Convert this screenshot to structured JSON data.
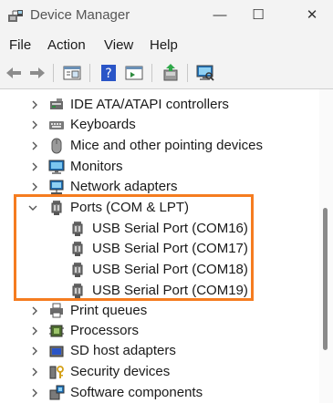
{
  "window": {
    "title": "Device Manager",
    "minimize_glyph": "—",
    "maximize_glyph": "☐",
    "close_glyph": "✕"
  },
  "menu": [
    "File",
    "Action",
    "View",
    "Help"
  ],
  "toolbar": {
    "buttons": [
      "back-icon",
      "forward-icon",
      "properties-icon",
      "help-icon",
      "view-icon",
      "update-driver-icon",
      "scan-hardware-icon"
    ]
  },
  "tree": {
    "items": [
      {
        "label": "IDE ATA/ATAPI controllers",
        "icon": "ide-controller-icon",
        "expanded": false
      },
      {
        "label": "Keyboards",
        "icon": "keyboard-icon",
        "expanded": false
      },
      {
        "label": "Mice and other pointing devices",
        "icon": "mouse-icon",
        "expanded": false
      },
      {
        "label": "Monitors",
        "icon": "monitor-icon",
        "expanded": false
      },
      {
        "label": "Network adapters",
        "icon": "network-adapter-icon",
        "expanded": false
      },
      {
        "label": "Ports (COM & LPT)",
        "icon": "port-icon",
        "expanded": true
      },
      {
        "label": "USB Serial Port (COM16)",
        "icon": "port-icon",
        "child": true
      },
      {
        "label": "USB Serial Port (COM17)",
        "icon": "port-icon",
        "child": true
      },
      {
        "label": "USB Serial Port (COM18)",
        "icon": "port-icon",
        "child": true
      },
      {
        "label": "USB Serial Port (COM19)",
        "icon": "port-icon",
        "child": true
      },
      {
        "label": "Print queues",
        "icon": "printer-icon",
        "expanded": false
      },
      {
        "label": "Processors",
        "icon": "processor-icon",
        "expanded": false
      },
      {
        "label": "SD host adapters",
        "icon": "sd-adapter-icon",
        "expanded": false
      },
      {
        "label": "Security devices",
        "icon": "security-device-icon",
        "expanded": false
      },
      {
        "label": "Software components",
        "icon": "software-component-icon",
        "expanded": false
      }
    ]
  },
  "colors": {
    "highlight": "#f57c20",
    "chrome": "#f3f3f3"
  }
}
